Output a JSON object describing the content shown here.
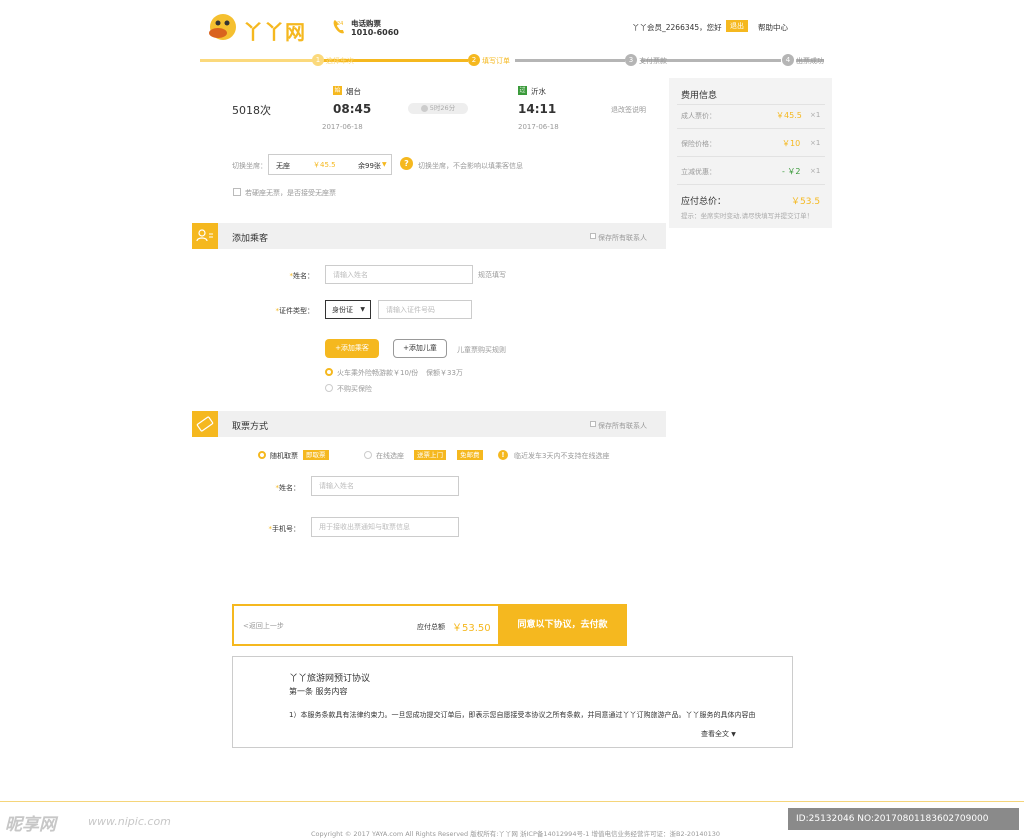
{
  "header": {
    "logo_text": "丫丫网",
    "phone_label": "电话购票",
    "phone_icon_num": "24",
    "phone_number": "1010-6060",
    "greeting": "丫丫会员_2266345，您好",
    "logout": "退出",
    "help": "帮助中心"
  },
  "progress": {
    "steps": [
      {
        "num": "1",
        "label": "选择车次",
        "state": "done"
      },
      {
        "num": "2",
        "label": "填写订单",
        "state": "current"
      },
      {
        "num": "3",
        "label": "支付票款",
        "state": "todo"
      },
      {
        "num": "4",
        "label": "出票成功",
        "state": "todo"
      }
    ],
    "colors": {
      "done": "#fbd97c",
      "current": "#f5b81f",
      "todo": "#b5b5b5"
    }
  },
  "train": {
    "number": "5018次",
    "from": {
      "icon": "始",
      "name": "烟台",
      "time": "08:45",
      "date": "2017-06-18"
    },
    "to": {
      "icon": "过",
      "name": "沂水",
      "time": "14:11",
      "date": "2017-06-18"
    },
    "duration": "5时26分",
    "change_note": "退改签说明"
  },
  "seat": {
    "label": "切换坐席：",
    "type": "无座",
    "price": "￥45.5",
    "remaining": "余99张",
    "tip": "切换坐席，不会影响以填乘客信息",
    "no_seat_accept": "若硬座无票，是否接受无座票"
  },
  "fees": {
    "title": "费用信息",
    "rows": [
      {
        "label": "成人票价：",
        "value": "￥45.5",
        "qty": "×1"
      },
      {
        "label": "保险价格：",
        "value": "￥10",
        "qty": "×1"
      },
      {
        "label": "立减优惠：",
        "value": "- ￥2",
        "qty": "×1"
      }
    ],
    "total_label": "应付总价：",
    "total_value": "￥53.5",
    "tip": "提示：坐席实时变动,请尽快填写并提交订单！"
  },
  "passenger": {
    "section_title": "添加乘客",
    "save_all": "保存所有联系人",
    "name_label": "姓名：",
    "name_placeholder": "请输入姓名",
    "name_hint": "规范填写",
    "id_label": "证件类型：",
    "id_type": "身份证",
    "id_placeholder": "请输入证件号码",
    "add_passenger": "+添加乘客",
    "add_child": "+添加儿童",
    "child_rules": "儿童票购买规则",
    "insurance_option": "火车乘外险畅游款￥10/份",
    "insurance_cover": "保额￥33万",
    "no_insurance": "不购买保险"
  },
  "pickup": {
    "section_title": "取票方式",
    "save_all": "保存所有联系人",
    "option1": "随机取票",
    "option1_tag": "即取票",
    "option2": "在线选座",
    "option2_tag1": "送票上门",
    "option2_tag2": "免邮费",
    "warn": "临近发车3天内不支持在线选座",
    "name_label": "姓名：",
    "name_placeholder": "请输入姓名",
    "phone_label": "手机号：",
    "phone_placeholder": "用于接收出票通知与取票信息"
  },
  "pay": {
    "back": "<返回上一步",
    "total_label": "应付总额",
    "total_value": "￥53.50",
    "button": "同意以下协议，去付款"
  },
  "agreement": {
    "title": "丫丫旅游网预订协议",
    "subtitle": "第一条 服务内容",
    "text": "1）本服务条款具有法律约束力。一旦您成功提交订单后，即表示您自愿接受本协议之所有条款，并同意通过丫丫订购旅游产品。丫丫服务的具体内容由",
    "more": "查看全文"
  },
  "footer": {
    "copyright": "Copyright © 2017 YAYA.com All Rights Reserved    版权所有:丫丫网    浙ICP备14012994号-1    增值电信业务经营许可证：浙B2-20140130",
    "watermark_left": "昵享网",
    "watermark_url": "www.nipic.com",
    "watermark_id": "ID:25132046 NO:20170801183602709000"
  }
}
